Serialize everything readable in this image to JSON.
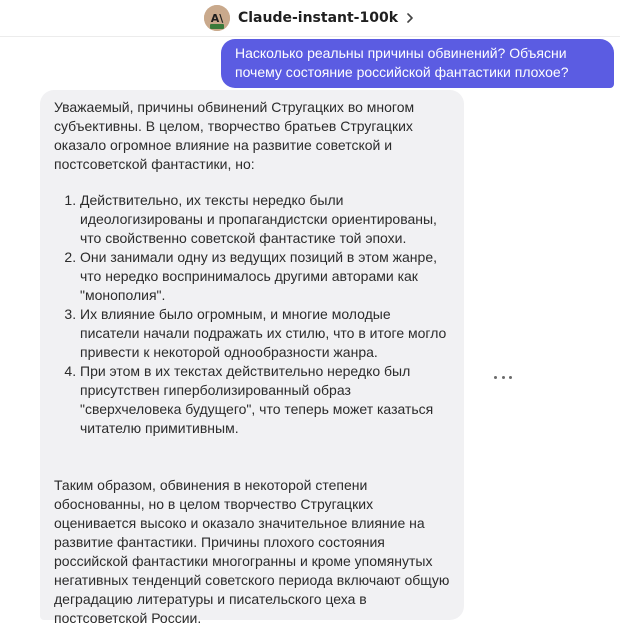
{
  "header": {
    "bot_name": "Claude-instant-100k",
    "avatar_icon": "claude-avatar-icon",
    "chevron_icon": "chevron-right-icon"
  },
  "user_message": {
    "text": "Насколько реальны причины обвинений? Объясни почему состояние российской фантастики плохое?"
  },
  "bot_message": {
    "intro": "Уважаемый, причины обвинений Стругацких во многом субъективны. В целом, творчество братьев Стругацких оказало огромное влияние на развитие советской и постсоветской фантастики, но:",
    "items": [
      "Действительно, их тексты нередко были идеологизированы и пропагандистски ориентированы, что свойственно советской фантастике той эпохи.",
      "Они занимали одну из ведущих позиций в этом жанре, что нередко воспринималось другими авторами как \"монополия\".",
      "Их влияние было огромным, и многие молодые писатели начали подражать их стилю, что в итоге могло привести к некоторой однообразности жанра.",
      "При этом в их текстах действительно нередко был присутствен гиперболизированный образ \"сверхчеловека будущего\", что теперь может казаться читателю примитивным."
    ],
    "conclusion": "Таким образом, обвинения в некоторой степени обоснованны, но в целом творчество Стругацких оценивается высоко и оказало значительное влияние на развитие фантастики. Причины плохого состояния российской фантастики многогранны и кроме упомянутых негативных тенденций советского периода включают общую деградацию литературы и писательского цеха в постсоветской России."
  },
  "actions": {
    "more_icon": "more-horizontal-icon"
  },
  "colors": {
    "user_bubble": "#5b5ce2",
    "bot_bubble": "#f1f1f3",
    "avatar_bg": "#c9a98c"
  }
}
